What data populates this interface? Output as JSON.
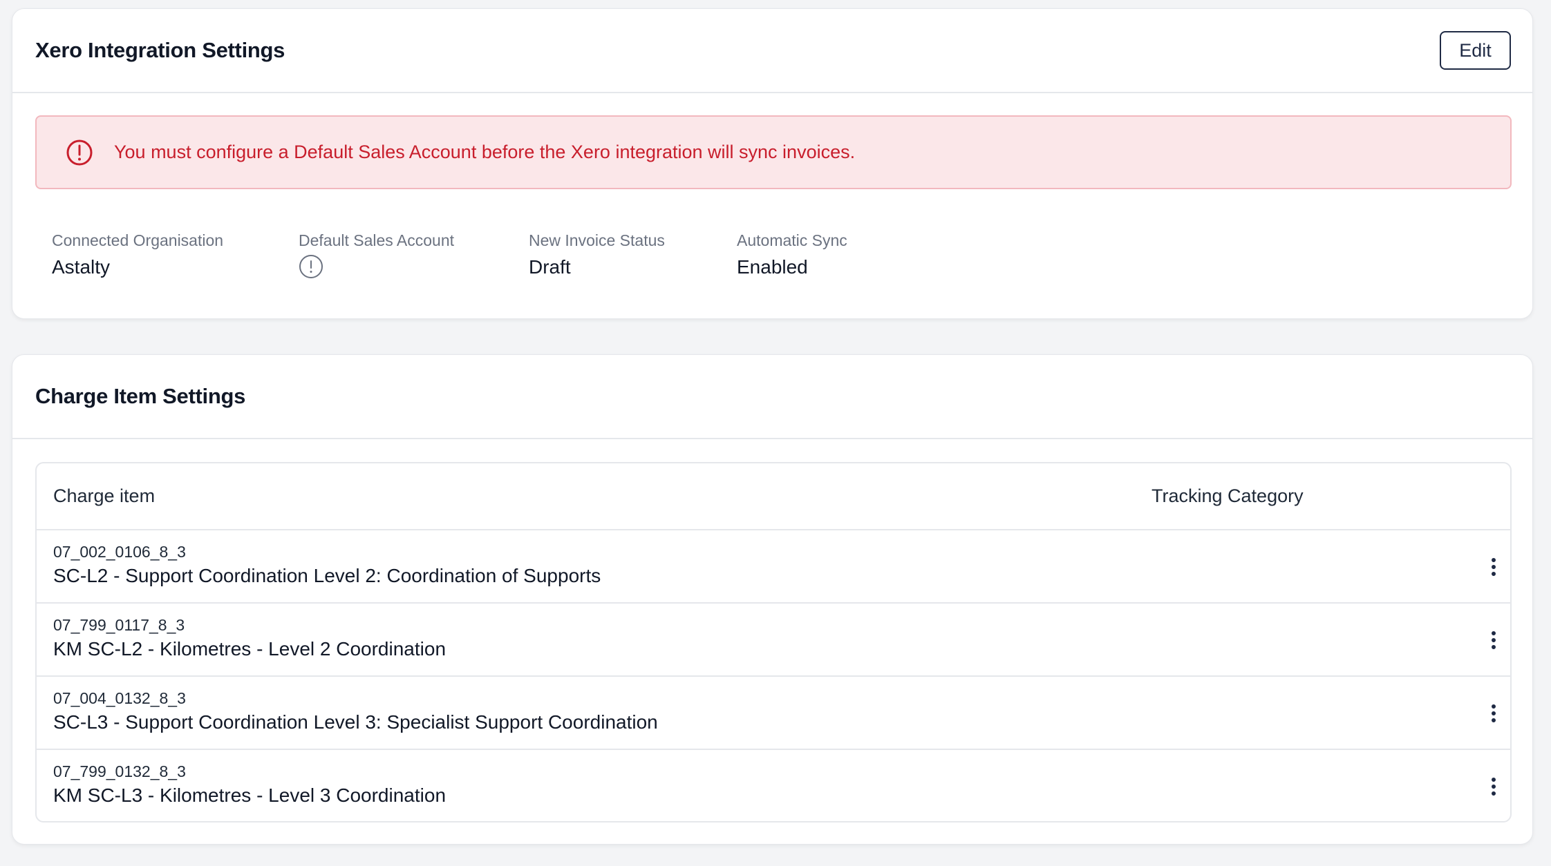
{
  "xero_card": {
    "title": "Xero Integration Settings",
    "edit_label": "Edit",
    "alert_text": "You must configure a Default Sales Account before the Xero integration will sync invoices.",
    "fields": {
      "connected_org": {
        "label": "Connected Organisation",
        "value": "Astalty"
      },
      "default_sales_account": {
        "label": "Default Sales Account",
        "value_icon": "warning-circle-icon"
      },
      "new_invoice_status": {
        "label": "New Invoice Status",
        "value": "Draft"
      },
      "automatic_sync": {
        "label": "Automatic Sync",
        "value": "Enabled"
      }
    }
  },
  "charge_card": {
    "title": "Charge Item Settings",
    "columns": {
      "charge_item": "Charge item",
      "tracking_category": "Tracking Category"
    },
    "rows": [
      {
        "code": "07_002_0106_8_3",
        "name": "SC-L2 - Support Coordination Level 2: Coordination of Supports",
        "tracking_category": ""
      },
      {
        "code": "07_799_0117_8_3",
        "name": "KM SC-L2 - Kilometres - Level 2 Coordination",
        "tracking_category": ""
      },
      {
        "code": "07_004_0132_8_3",
        "name": "SC-L3 - Support Coordination Level 3: Specialist Support Coordination",
        "tracking_category": ""
      },
      {
        "code": "07_799_0132_8_3",
        "name": "KM SC-L3 - Kilometres - Level 3 Coordination",
        "tracking_category": ""
      }
    ]
  },
  "colors": {
    "page_bg": "#f3f4f6",
    "alert_bg": "#fbe7e9",
    "alert_text": "#c81e2c",
    "edit_border": "#1f2a44"
  }
}
